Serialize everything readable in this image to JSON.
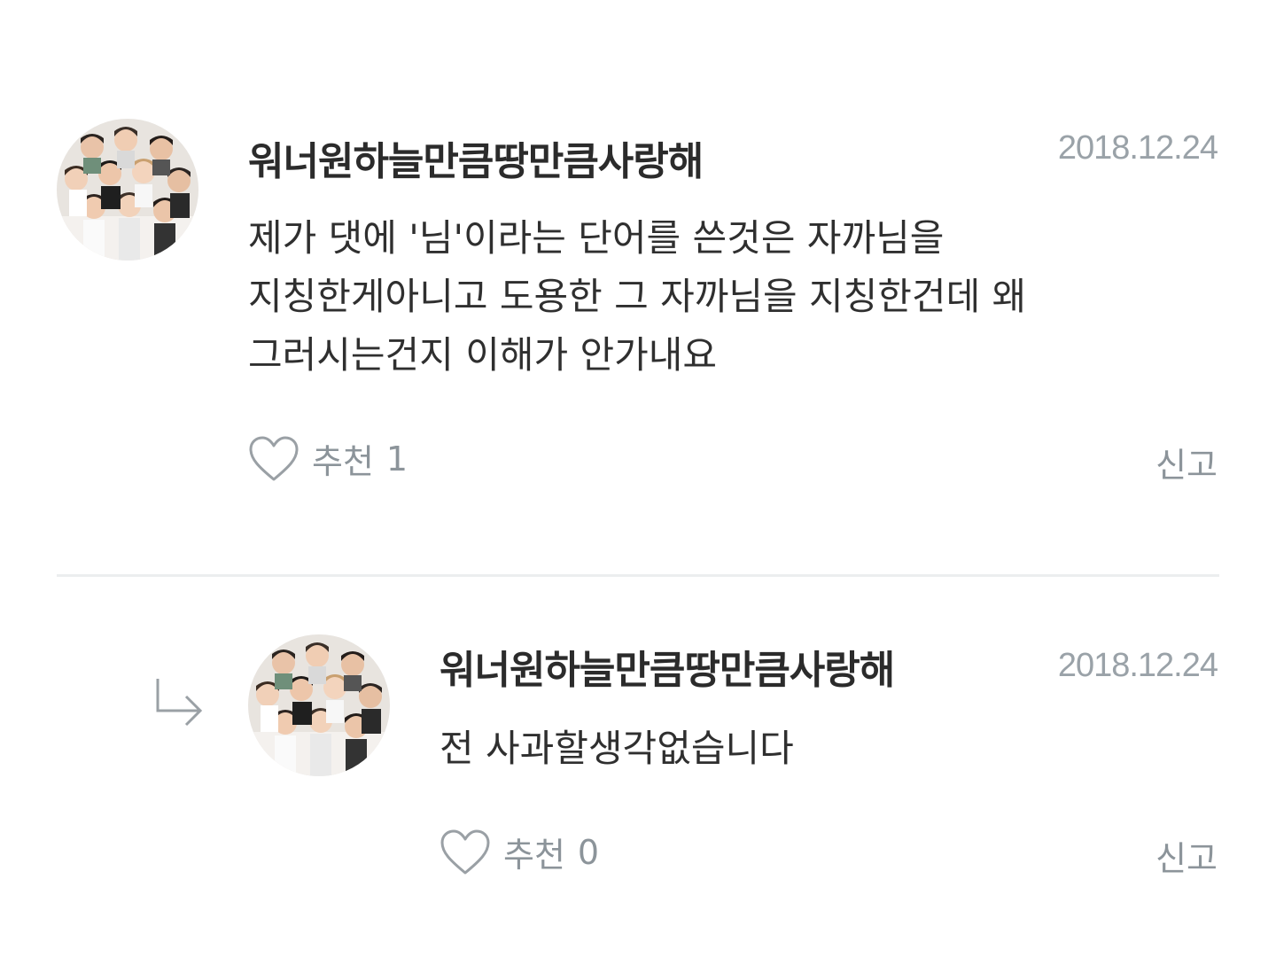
{
  "comments": [
    {
      "author": "워너원하늘만큼땅만큼사랑해",
      "date": "2018.12.24",
      "text": "제가 댓에 '님'이라는 단어를 쓴것은 자까님을\n지칭한게아니고 도용한 그 자까님을 지칭한건데 왜\n그러시는건지 이해가 안가내요",
      "like_label": "추천",
      "like_count": "1",
      "report_label": "신고",
      "avatar_icon": "group-photo-avatar"
    },
    {
      "author": "워너원하늘만큼땅만큼사랑해",
      "date": "2018.12.24",
      "text": "전 사과할생각없습니다",
      "like_label": "추천",
      "like_count": "0",
      "report_label": "신고",
      "avatar_icon": "group-photo-avatar",
      "is_reply": true
    }
  ],
  "icons": {
    "like": "heart-outline-icon",
    "reply": "reply-arrow-icon"
  },
  "colors": {
    "text": "#2f2f2f",
    "muted": "#8c949a",
    "date": "#9aa2a8",
    "divider": "#eceeef"
  }
}
